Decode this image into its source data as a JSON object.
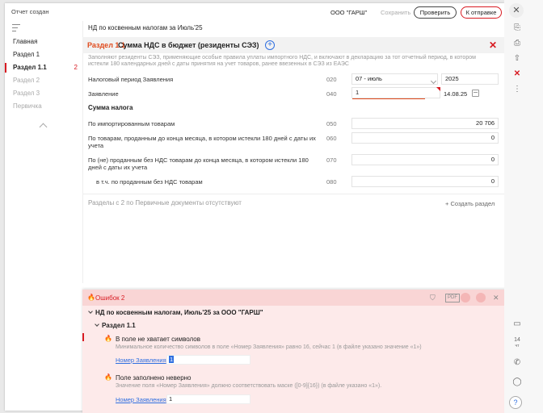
{
  "topbar": {
    "doc_created": "Отчет создан",
    "org": "ООО \"ГАРШ\"",
    "save": "Сохранить",
    "check": "Проверить",
    "send": "К отправке"
  },
  "sidebar": {
    "items": [
      {
        "label": "Главная"
      },
      {
        "label": "Раздел 1"
      },
      {
        "label": "Раздел 1.1",
        "badge": "2"
      },
      {
        "label": "Раздел 2"
      },
      {
        "label": "Раздел 3"
      },
      {
        "label": "Первичка"
      }
    ]
  },
  "doc": {
    "title": "НД по косвенным налогам за Июль'25"
  },
  "section": {
    "code": "Раздел 1.1",
    "title": "Сумма НДС в бюджет (резиденты СЭЗ)",
    "hint": "Заполняют резиденты СЭЗ, применяющие особые правила уплаты импортного НДС, и включают в декларацию за тот отчетный период, в котором истекли 180 календарных дней с даты принятия на учет товаров, ранее ввезенных в СЭЗ из ЕАЭС"
  },
  "form": {
    "period_label": "Налоговый период Заявления",
    "period_code": "020",
    "period_value": "07 - июль",
    "year_value": "2025",
    "decl_label": "Заявление",
    "decl_code": "040",
    "decl_value": "1",
    "decl_date": "14.08.25",
    "tax_sum_heading": "Сумма налога",
    "imported_label": "По импортированным товарам",
    "imported_code": "050",
    "imported_value": "20 706",
    "sold_label": "По товарам, проданным до конца месяца, в котором истекли 180 дней с даты их учета",
    "sold_code": "060",
    "sold_value": "0",
    "unsold_label": "По (не) проданным без НДС товарам до конца месяца, в котором истекли 180 дней с даты их учета",
    "unsold_code": "070",
    "unsold_value": "0",
    "incl_label": "в т.ч. по проданным без НДС товарам",
    "incl_code": "080",
    "incl_value": "0"
  },
  "footer": {
    "no_sections": "Разделы с 2 по Первичные документы отсутствуют",
    "create_section": "+ Создать раздел"
  },
  "errors": {
    "title": "Ошибок 2",
    "tree_root": "НД по косвенным налогам, Июль'25 за ООО \"ГАРШ\"",
    "tree_section": "Раздел 1.1",
    "items": [
      {
        "title": "В поле не хватает символов",
        "desc": "Минимальное количество символов в поле «Номер Заявления» равно 16, сейчас 1 (в файле указано значение «1»)",
        "link": "Номер Заявления",
        "value": "1"
      },
      {
        "title": "Поле заполнено неверно",
        "desc": "Значение поля «Номер Заявления» должно соответствовать маске ([0-9]{16}) (в файле указано «1»).",
        "link": "Номер Заявления",
        "value": "1"
      }
    ]
  },
  "rail": {
    "calendar_day": "14",
    "calendar_month": "чт",
    "help": "?"
  },
  "colors": {
    "accent_red": "#d81b22",
    "section_code": "#e04a1c",
    "link_blue": "#2f6fe0",
    "error_bg": "#fdeaea"
  }
}
